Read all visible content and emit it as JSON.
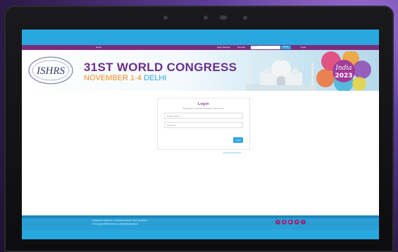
{
  "nav": {
    "home": "Home",
    "page_settings": "Page Settings",
    "all_links": "All Links",
    "search_placeholder": "search...",
    "search_button": "Search",
    "login": "Login"
  },
  "banner": {
    "title": "31ST WORLD CONGRESS",
    "date": "NOVEMBER 1-4",
    "city": "DELHI",
    "badge_line1": "India",
    "badge_line2": "2023",
    "logo_text": "ISHRS"
  },
  "login": {
    "title": "Login",
    "subtitle": "Please log in to your account below to join this site.",
    "email_placeholder": "E-Mail Address",
    "password_placeholder": "Password",
    "button": "Login",
    "forgot": "Forgot the password?"
  },
  "footer": {
    "line1": "Designed in Cadmore  |  Technical Support  |  Give Feedback",
    "line2": "© Copyright 2023 Cadmore. All Rights Reserved."
  },
  "colors": {
    "purple": "#7b2d7d",
    "blue": "#29a8e0",
    "orange": "#f28b1c"
  }
}
